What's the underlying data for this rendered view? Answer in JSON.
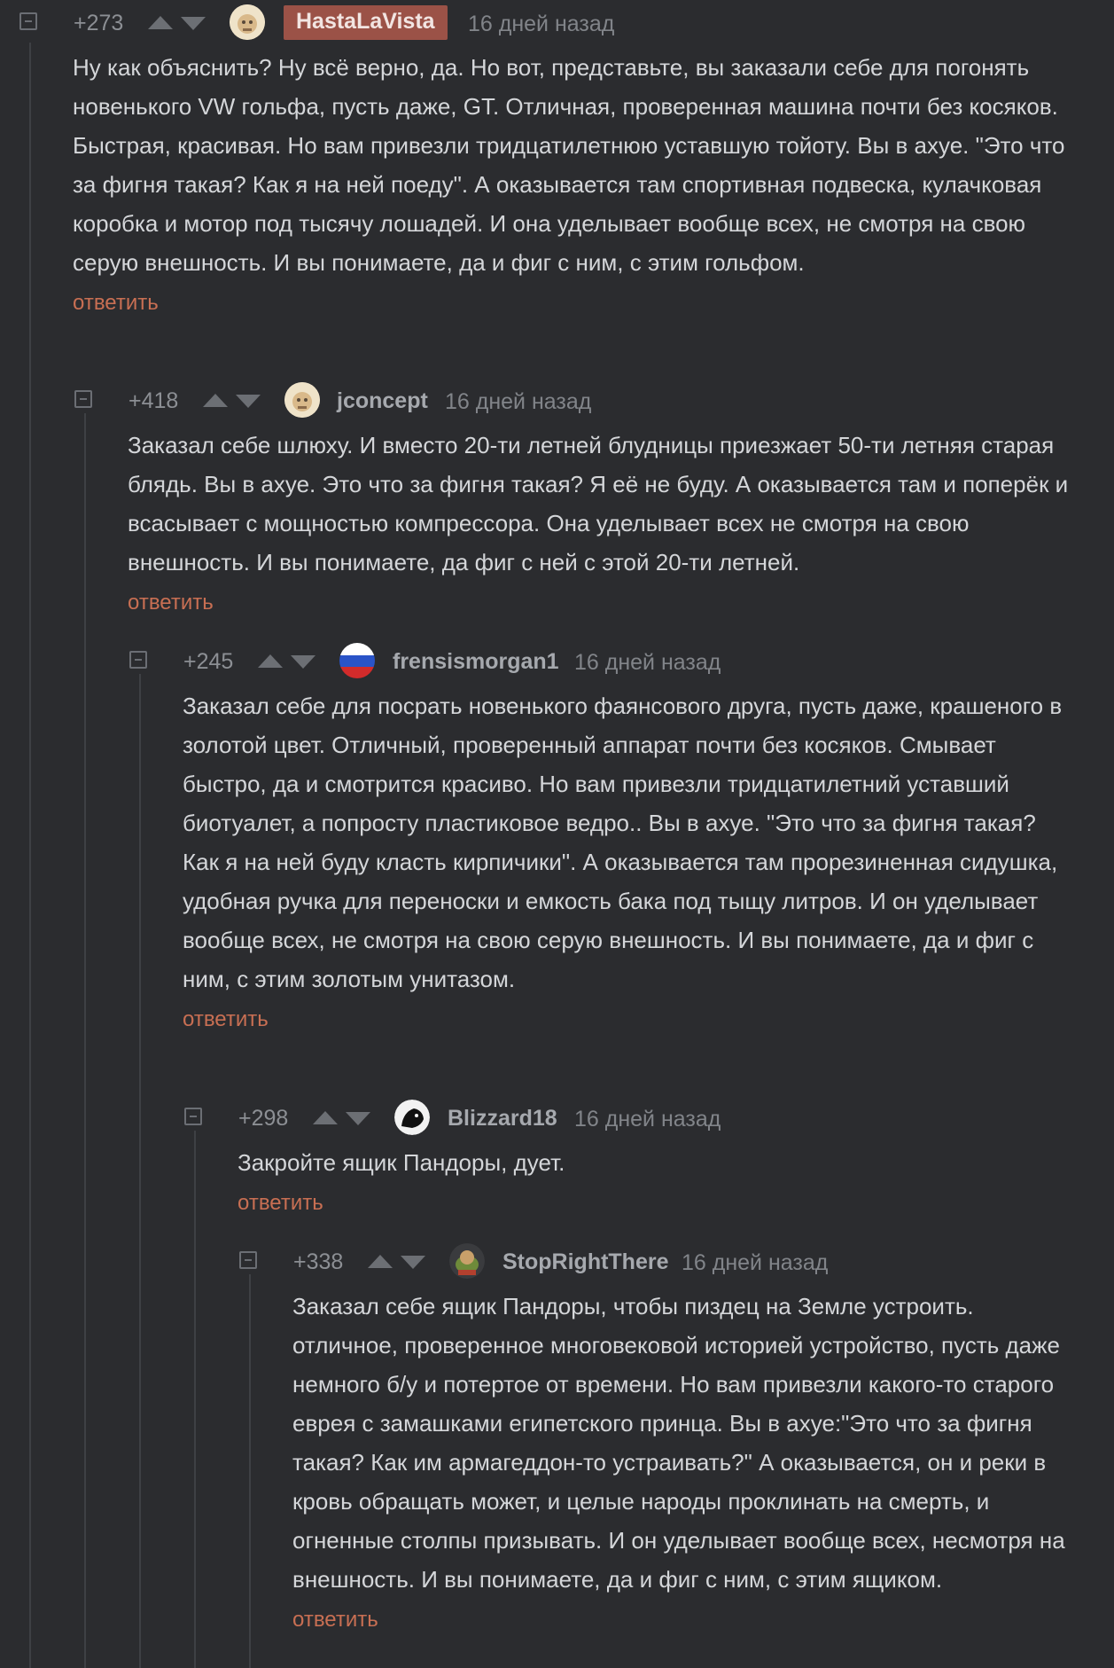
{
  "comments": [
    {
      "rating": "+273",
      "user": "HastaLaVista",
      "date": "16 дней назад",
      "text": "Ну как объяснить? Ну всё верно, да. Но вот, представьте, вы заказали себе для погонять новенького VW гольфа, пусть даже, GT. Отличная, проверенная машина почти без косяков. Быстрая, красивая. Но вам привезли тридцатилетнюю уставшую тойоту. Вы в ахуе. \"Это что за фигня такая? Как я на ней поеду\". А оказывается там спортивная подвеска, кулачковая коробка и мотор под тысячу лошадей. И она уделывает вообще всех, не смотря на свою серую внешность. И вы понимаете, да и фиг с ним, с этим гольфом.",
      "reply": "ответить"
    },
    {
      "rating": "+418",
      "user": "jconcept",
      "date": "16 дней назад",
      "text": "Заказал себе шлюху. И вместо 20-ти летней блудницы приезжает 50-ти летняя старая блядь. Вы в ахуе. Это что за фигня такая? Я её не буду. А оказывается там и поперёк и всасывает с мощностью компрессора. Она уделывает всех не смотря на свою внешность. И вы понимаете, да фиг с ней с этой 20-ти летней.",
      "reply": "ответить"
    },
    {
      "rating": "+245",
      "user": "frensismorgan1",
      "date": "16 дней назад",
      "text": "Заказал себе для посрать новенького фаянсового друга, пусть даже, крашеного в золотой цвет. Отличный, проверенный аппарат почти без косяков. Смывает быстро, да и смотрится красиво. Но вам привезли тридцатилетний уставший биотуалет, а попросту пластиковое ведро.. Вы в ахуе. \"Это что за фигня такая? Как я на ней буду класть кирпичики\". А оказывается там прорезиненная сидушка, удобная ручка для переноски и емкость бака под тыщу литров. И он уделывает вообще всех, не смотря на свою серую внешность. И вы понимаете, да и фиг с ним, с этим золотым унитазом.",
      "reply": "ответить"
    },
    {
      "rating": "+298",
      "user": "Blizzard18",
      "date": "16 дней назад",
      "text": "Закройте ящик Пандоры, дует.",
      "reply": "ответить"
    },
    {
      "rating": "+338",
      "user": "StopRightThere",
      "date": "16 дней назад",
      "text": "Заказал себе ящик Пандоры, чтобы пиздец на Земле устроить. отличное, проверенное многовековой историей устройство, пусть даже немного б/у и потертое от времени. Но вам привезли какого-то старого еврея с замашками египетского принца. Вы в ахуе:\"Это что за фигня такая? Как им армагеддон-то устраивать?\" А оказывается, он и реки в кровь обращать может, и целые народы проклинать на смерть, и огненные столпы призывать. И он уделывает вообще всех, несмотря на внешность. И вы понимаете, да и фиг с ним, с этим ящиком.",
      "reply": "ответить"
    }
  ],
  "icons": {
    "collapse": "minus-square-icon",
    "upvote": "arrow-up-icon",
    "downvote": "arrow-down-icon"
  },
  "colors": {
    "background": "#2b2c2f",
    "reply": "#c86f53",
    "highlight_user": "#9b5247"
  }
}
